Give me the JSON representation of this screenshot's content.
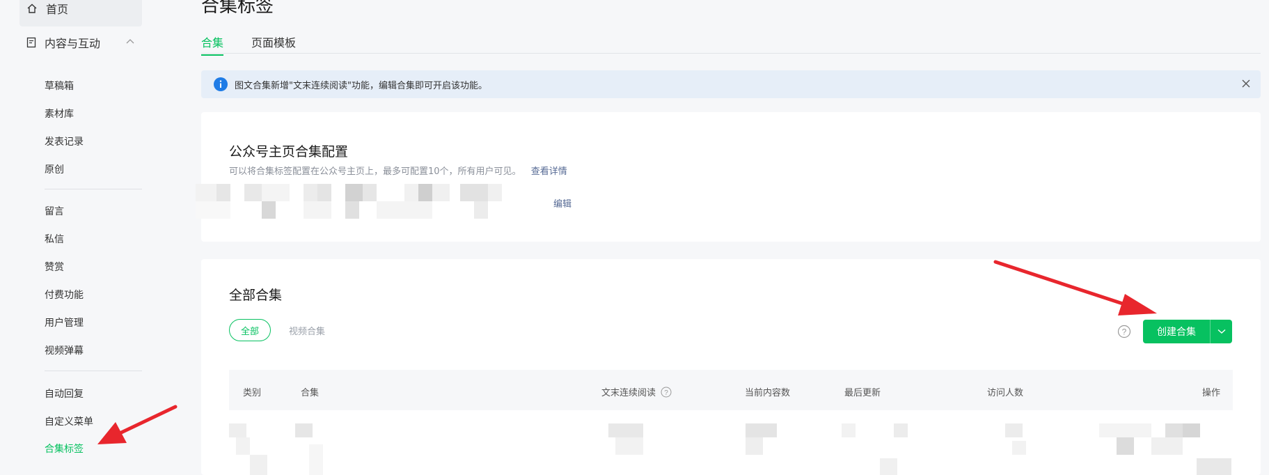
{
  "sidebar": {
    "home": "首页",
    "group": "内容与互动",
    "items": [
      "草稿箱",
      "素材库",
      "发表记录",
      "原创",
      "留言",
      "私信",
      "赞赏",
      "付费功能",
      "用户管理",
      "视频弹幕",
      "自动回复",
      "自定义菜单",
      "合集标签"
    ],
    "active_item": "合集标签"
  },
  "page": {
    "title": "合集标签",
    "tabs": [
      "合集",
      "页面模板"
    ],
    "active_tab": "合集"
  },
  "notice": {
    "text": "图文合集新增\"文末连续阅读\"功能，编辑合集即可开启该功能。"
  },
  "homepage_config": {
    "title": "公众号主页合集配置",
    "description": "可以将合集标签配置在公众号主页上，最多可配置10个，所有用户可见。",
    "details_link": "查看详情",
    "edit_link": "编辑"
  },
  "all_collections": {
    "title": "全部合集",
    "filters": [
      "全部",
      "视频合集"
    ],
    "create_button": "创建合集",
    "table_headers": {
      "category": "类别",
      "collection": "合集",
      "continuous_read": "文末连续阅读",
      "content_count": "当前内容数",
      "last_update": "最后更新",
      "visitors": "访问人数",
      "actions": "操作"
    }
  },
  "colors": {
    "accent": "#07c160",
    "link": "#576b95",
    "notice_bg": "#e6eef8",
    "annotation_arrow": "#e8262d"
  }
}
